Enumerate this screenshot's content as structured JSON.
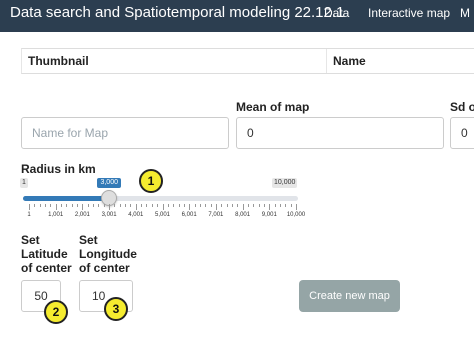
{
  "app": {
    "title": "Data search and Spatiotemporal modeling 22.12.1",
    "nav": [
      "Data",
      "Interactive map",
      "M"
    ]
  },
  "table": {
    "columns": [
      "Thumbnail",
      "Name"
    ]
  },
  "form": {
    "map_name": {
      "value": "",
      "placeholder": "Name for Map"
    },
    "mean": {
      "label": "Mean of map",
      "value": "0"
    },
    "sd": {
      "label": "Sd of",
      "value": "0"
    },
    "radius": {
      "label": "Radius in km",
      "min_label": "1",
      "max_label": "10,000",
      "value_label": "3,000",
      "value": 3000,
      "min": 1,
      "max": 10000,
      "ticks": [
        "1",
        "1,001",
        "2,001",
        "3,001",
        "4,001",
        "5,001",
        "6,001",
        "7,001",
        "8,001",
        "9,001",
        "10,000"
      ]
    },
    "latitude": {
      "label": "Set Latitude of center",
      "value": "50"
    },
    "longitude": {
      "label": "Set Longitude of center",
      "value": "10"
    },
    "create_button": "Create new map"
  },
  "markers": [
    "1",
    "2",
    "3"
  ],
  "colors": {
    "navbar": "#2c3e50",
    "slider_fill": "#337ab7",
    "button": "#95a5a6",
    "marker": "#f5ec2f"
  }
}
